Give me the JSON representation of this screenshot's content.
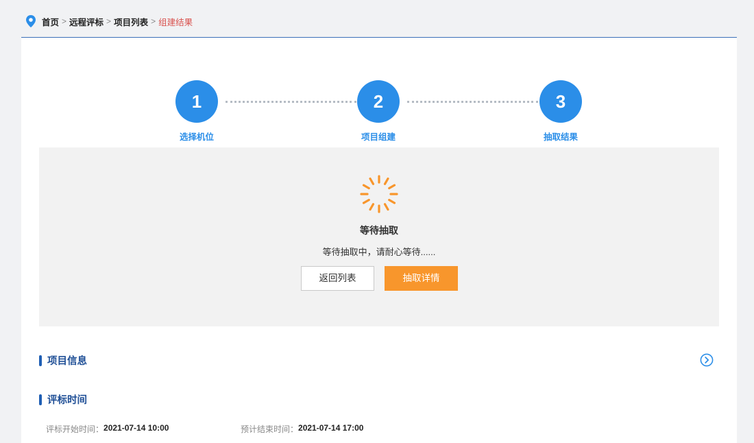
{
  "breadcrumb": {
    "items": [
      "首页",
      "远程评标",
      "项目列表"
    ],
    "separator": ">",
    "current": "组建结果"
  },
  "steps": [
    {
      "number": "1",
      "label": "选择机位"
    },
    {
      "number": "2",
      "label": "项目组建"
    },
    {
      "number": "3",
      "label": "抽取结果"
    }
  ],
  "status": {
    "title": "等待抽取",
    "description": "等待抽取中，请耐心等待......",
    "back_button": "返回列表",
    "detail_button": "抽取详情"
  },
  "sections": {
    "project_info": "项目信息",
    "bid_time": "评标时间"
  },
  "times": {
    "start_label": "评标开始时间：",
    "start_value": "2021-07-14 10:00",
    "end_label": "预计结束时间：",
    "end_value": "2021-07-14 17:00"
  },
  "colors": {
    "accent": "#2b8ee8",
    "section": "#1f4f96",
    "primary_button": "#f8962c",
    "breadcrumb_current": "#d9534f",
    "spinner": "#f8962c"
  },
  "icons": {
    "location": "location-pin-icon",
    "spinner": "loading-spinner-icon",
    "expand": "chevron-circle-right-icon"
  }
}
